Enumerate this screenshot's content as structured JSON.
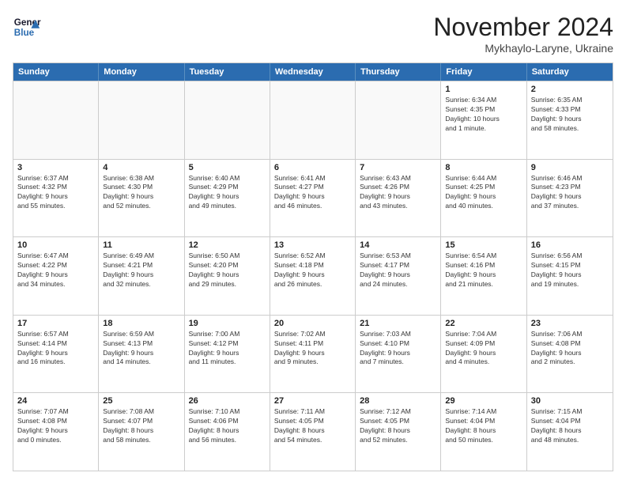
{
  "header": {
    "logo_line1": "General",
    "logo_line2": "Blue",
    "month_title": "November 2024",
    "location": "Mykhaylo-Laryne, Ukraine"
  },
  "weekdays": [
    "Sunday",
    "Monday",
    "Tuesday",
    "Wednesday",
    "Thursday",
    "Friday",
    "Saturday"
  ],
  "rows": [
    [
      {
        "day": "",
        "info": "",
        "empty": true
      },
      {
        "day": "",
        "info": "",
        "empty": true
      },
      {
        "day": "",
        "info": "",
        "empty": true
      },
      {
        "day": "",
        "info": "",
        "empty": true
      },
      {
        "day": "",
        "info": "",
        "empty": true
      },
      {
        "day": "1",
        "info": "Sunrise: 6:34 AM\nSunset: 4:35 PM\nDaylight: 10 hours\nand 1 minute.",
        "empty": false
      },
      {
        "day": "2",
        "info": "Sunrise: 6:35 AM\nSunset: 4:33 PM\nDaylight: 9 hours\nand 58 minutes.",
        "empty": false
      }
    ],
    [
      {
        "day": "3",
        "info": "Sunrise: 6:37 AM\nSunset: 4:32 PM\nDaylight: 9 hours\nand 55 minutes.",
        "empty": false
      },
      {
        "day": "4",
        "info": "Sunrise: 6:38 AM\nSunset: 4:30 PM\nDaylight: 9 hours\nand 52 minutes.",
        "empty": false
      },
      {
        "day": "5",
        "info": "Sunrise: 6:40 AM\nSunset: 4:29 PM\nDaylight: 9 hours\nand 49 minutes.",
        "empty": false
      },
      {
        "day": "6",
        "info": "Sunrise: 6:41 AM\nSunset: 4:27 PM\nDaylight: 9 hours\nand 46 minutes.",
        "empty": false
      },
      {
        "day": "7",
        "info": "Sunrise: 6:43 AM\nSunset: 4:26 PM\nDaylight: 9 hours\nand 43 minutes.",
        "empty": false
      },
      {
        "day": "8",
        "info": "Sunrise: 6:44 AM\nSunset: 4:25 PM\nDaylight: 9 hours\nand 40 minutes.",
        "empty": false
      },
      {
        "day": "9",
        "info": "Sunrise: 6:46 AM\nSunset: 4:23 PM\nDaylight: 9 hours\nand 37 minutes.",
        "empty": false
      }
    ],
    [
      {
        "day": "10",
        "info": "Sunrise: 6:47 AM\nSunset: 4:22 PM\nDaylight: 9 hours\nand 34 minutes.",
        "empty": false
      },
      {
        "day": "11",
        "info": "Sunrise: 6:49 AM\nSunset: 4:21 PM\nDaylight: 9 hours\nand 32 minutes.",
        "empty": false
      },
      {
        "day": "12",
        "info": "Sunrise: 6:50 AM\nSunset: 4:20 PM\nDaylight: 9 hours\nand 29 minutes.",
        "empty": false
      },
      {
        "day": "13",
        "info": "Sunrise: 6:52 AM\nSunset: 4:18 PM\nDaylight: 9 hours\nand 26 minutes.",
        "empty": false
      },
      {
        "day": "14",
        "info": "Sunrise: 6:53 AM\nSunset: 4:17 PM\nDaylight: 9 hours\nand 24 minutes.",
        "empty": false
      },
      {
        "day": "15",
        "info": "Sunrise: 6:54 AM\nSunset: 4:16 PM\nDaylight: 9 hours\nand 21 minutes.",
        "empty": false
      },
      {
        "day": "16",
        "info": "Sunrise: 6:56 AM\nSunset: 4:15 PM\nDaylight: 9 hours\nand 19 minutes.",
        "empty": false
      }
    ],
    [
      {
        "day": "17",
        "info": "Sunrise: 6:57 AM\nSunset: 4:14 PM\nDaylight: 9 hours\nand 16 minutes.",
        "empty": false
      },
      {
        "day": "18",
        "info": "Sunrise: 6:59 AM\nSunset: 4:13 PM\nDaylight: 9 hours\nand 14 minutes.",
        "empty": false
      },
      {
        "day": "19",
        "info": "Sunrise: 7:00 AM\nSunset: 4:12 PM\nDaylight: 9 hours\nand 11 minutes.",
        "empty": false
      },
      {
        "day": "20",
        "info": "Sunrise: 7:02 AM\nSunset: 4:11 PM\nDaylight: 9 hours\nand 9 minutes.",
        "empty": false
      },
      {
        "day": "21",
        "info": "Sunrise: 7:03 AM\nSunset: 4:10 PM\nDaylight: 9 hours\nand 7 minutes.",
        "empty": false
      },
      {
        "day": "22",
        "info": "Sunrise: 7:04 AM\nSunset: 4:09 PM\nDaylight: 9 hours\nand 4 minutes.",
        "empty": false
      },
      {
        "day": "23",
        "info": "Sunrise: 7:06 AM\nSunset: 4:08 PM\nDaylight: 9 hours\nand 2 minutes.",
        "empty": false
      }
    ],
    [
      {
        "day": "24",
        "info": "Sunrise: 7:07 AM\nSunset: 4:08 PM\nDaylight: 9 hours\nand 0 minutes.",
        "empty": false
      },
      {
        "day": "25",
        "info": "Sunrise: 7:08 AM\nSunset: 4:07 PM\nDaylight: 8 hours\nand 58 minutes.",
        "empty": false
      },
      {
        "day": "26",
        "info": "Sunrise: 7:10 AM\nSunset: 4:06 PM\nDaylight: 8 hours\nand 56 minutes.",
        "empty": false
      },
      {
        "day": "27",
        "info": "Sunrise: 7:11 AM\nSunset: 4:05 PM\nDaylight: 8 hours\nand 54 minutes.",
        "empty": false
      },
      {
        "day": "28",
        "info": "Sunrise: 7:12 AM\nSunset: 4:05 PM\nDaylight: 8 hours\nand 52 minutes.",
        "empty": false
      },
      {
        "day": "29",
        "info": "Sunrise: 7:14 AM\nSunset: 4:04 PM\nDaylight: 8 hours\nand 50 minutes.",
        "empty": false
      },
      {
        "day": "30",
        "info": "Sunrise: 7:15 AM\nSunset: 4:04 PM\nDaylight: 8 hours\nand 48 minutes.",
        "empty": false
      }
    ]
  ]
}
